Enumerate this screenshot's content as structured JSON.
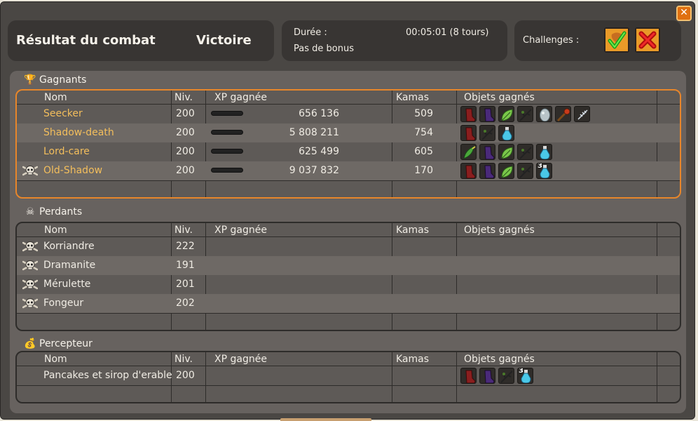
{
  "header": {
    "title": "Résultat du combat",
    "result": "Victoire",
    "duration_label": "Durée :",
    "duration_value": "00:05:01 (8 tours)",
    "bonus": "Pas de bonus",
    "challenges_label": "Challenges :"
  },
  "columns": {
    "name": "Nom",
    "level": "Niv.",
    "xp": "XP gagnée",
    "kamas": "Kamas",
    "items": "Objets gagnés"
  },
  "winners": {
    "title": "Gagnants",
    "rows": [
      {
        "name": "Seecker",
        "level": "200",
        "xp": "656 136",
        "kamas": "509",
        "dead": false,
        "items": [
          "boots-red",
          "boots-purple",
          "leaf-green",
          "branch-dark",
          "egg-white",
          "wand-brown",
          "fish-bone"
        ],
        "qty": {}
      },
      {
        "name": "Shadow-death",
        "level": "200",
        "xp": "5 808 211",
        "kamas": "754",
        "dead": false,
        "items": [
          "boots-red",
          "branch-dark",
          "potion-blue"
        ],
        "qty": {}
      },
      {
        "name": "Lord-care",
        "level": "200",
        "xp": "625 499",
        "kamas": "605",
        "dead": false,
        "items": [
          "feather-green",
          "boots-purple",
          "leaf-green",
          "branch-dark",
          "potion-blue"
        ],
        "qty": {}
      },
      {
        "name": "Old-Shadow",
        "level": "200",
        "xp": "9 037 832",
        "kamas": "170",
        "dead": true,
        "items": [
          "boots-red",
          "boots-purple",
          "leaf-green",
          "branch-dark",
          "potion-blue"
        ],
        "qty": {
          "4": "3"
        }
      }
    ]
  },
  "losers": {
    "title": "Perdants",
    "rows": [
      {
        "name": "Korriandre",
        "level": "222"
      },
      {
        "name": "Dramanite",
        "level": "191"
      },
      {
        "name": "Mérulette",
        "level": "201"
      },
      {
        "name": "Fongeur",
        "level": "202"
      }
    ]
  },
  "collector": {
    "title": "Percepteur",
    "rows": [
      {
        "name": "Pancakes et sirop d'erable",
        "level": "200",
        "items": [
          "boots-red",
          "boots-purple",
          "branch-dark",
          "potion-blue"
        ],
        "qty": {
          "3": "3"
        }
      }
    ]
  },
  "colors": {
    "accent": "#e8862a",
    "gold_name": "#f3be5c",
    "panel": "#67625f",
    "window": "#4a4744"
  },
  "icons": {
    "close": "close-icon",
    "challenge_success": "check-icon",
    "challenge_fail": "cross-icon",
    "trophy": "trophy-icon",
    "skull": "skull-icon",
    "bag": "bag-icon"
  }
}
